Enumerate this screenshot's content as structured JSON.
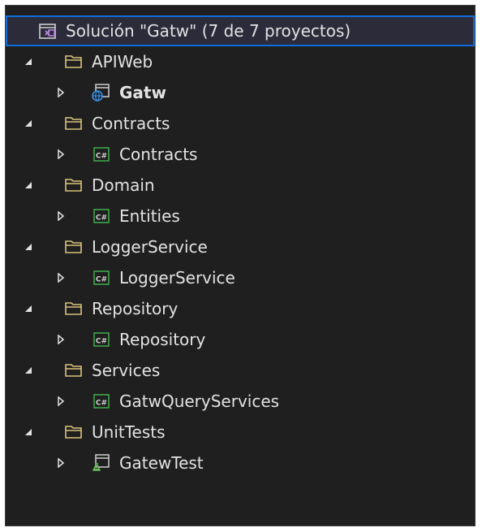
{
  "colors": {
    "background": "#1f1f1f",
    "text": "#e2e2e2",
    "selection_border": "#0f6ddb",
    "folder": "#d8c27a",
    "csharp": "#3fa44a",
    "web": "#3a8ee6",
    "test": "#6bbf5c"
  },
  "solution": {
    "icon": "solution-icon",
    "label": "Solución \"Gatw\" (7 de 7 proyectos)"
  },
  "tree": [
    {
      "folder": "APIWeb",
      "folder_icon": "folder-icon",
      "project": "Gatw",
      "project_icon": "web-project-icon",
      "bold": true
    },
    {
      "folder": "Contracts",
      "folder_icon": "folder-icon",
      "project": "Contracts",
      "project_icon": "csharp-project-icon"
    },
    {
      "folder": "Domain",
      "folder_icon": "folder-icon",
      "project": "Entities",
      "project_icon": "csharp-project-icon"
    },
    {
      "folder": "LoggerService",
      "folder_icon": "folder-icon",
      "project": "LoggerService",
      "project_icon": "csharp-project-icon"
    },
    {
      "folder": "Repository",
      "folder_icon": "folder-icon",
      "project": "Repository",
      "project_icon": "csharp-project-icon"
    },
    {
      "folder": "Services",
      "folder_icon": "folder-icon",
      "project": "GatwQueryServices",
      "project_icon": "csharp-project-icon"
    },
    {
      "folder": "UnitTests",
      "folder_icon": "folder-icon",
      "project": "GatewTest",
      "project_icon": "test-project-icon"
    }
  ],
  "csharp_badge": "C#"
}
